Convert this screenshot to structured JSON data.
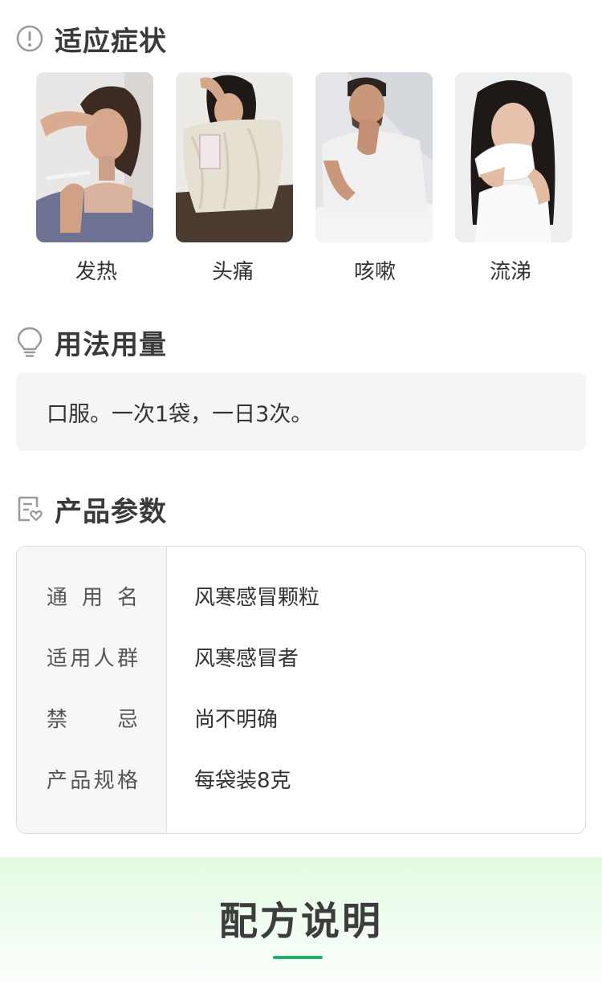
{
  "sections": {
    "symptoms": {
      "title": "适应症状",
      "icon": "exclamation-circle-icon"
    },
    "usage": {
      "title": "用法用量",
      "icon": "lightbulb-icon"
    },
    "params": {
      "title": "产品参数",
      "icon": "document-heart-icon"
    }
  },
  "symptoms": [
    {
      "label": "发热",
      "image": "woman-with-thermometer-photo"
    },
    {
      "label": "头痛",
      "image": "woman-wrapped-in-blanket-photo"
    },
    {
      "label": "咳嗽",
      "image": "man-coughing-photo"
    },
    {
      "label": "流涕",
      "image": "woman-blowing-nose-photo"
    }
  ],
  "usage": {
    "text": "口服。一次1袋，一日3次。"
  },
  "params": [
    {
      "key": "通用名",
      "value": "风寒感冒颗粒"
    },
    {
      "key": "适用人群",
      "value": "风寒感冒者"
    },
    {
      "key": "禁忌",
      "value": "尚不明确"
    },
    {
      "key": "产品规格",
      "value": "每袋装8克"
    }
  ],
  "formula": {
    "title": "配方说明",
    "accent_color": "#1db26b"
  },
  "colors": {
    "heading": "#3a3a3a",
    "panel": "#f5f5f5",
    "border": "#dddddd",
    "gradient_top": "#e1fbe0"
  }
}
